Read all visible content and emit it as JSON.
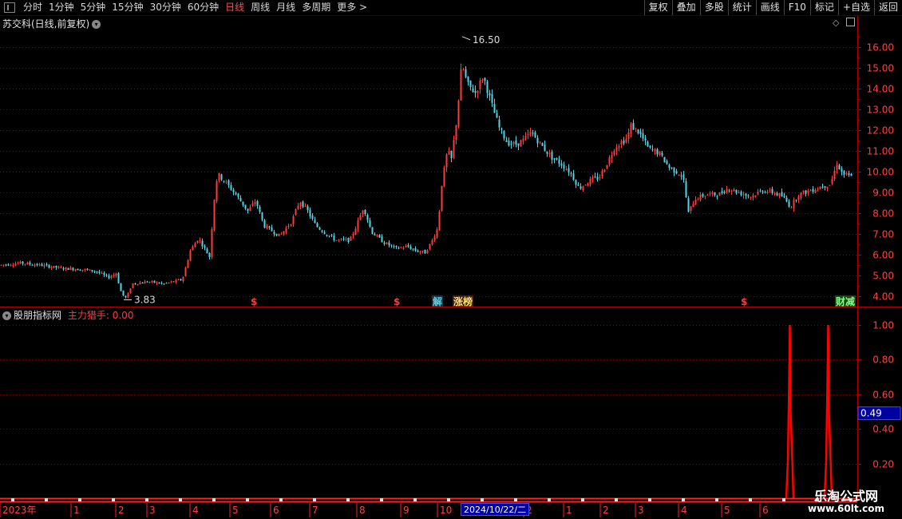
{
  "toolbar": {
    "tabs": [
      "分时",
      "1分钟",
      "5分钟",
      "15分钟",
      "30分钟",
      "60分钟",
      "日线",
      "周线",
      "月线",
      "多周期",
      "更多 >"
    ],
    "active_tab": 6,
    "right_buttons": [
      "复权",
      "叠加",
      "多股",
      "统计",
      "画线",
      "F10",
      "标记",
      "+自选",
      "返回"
    ]
  },
  "main_panel": {
    "title": "苏交科(日线,前复权)",
    "y_ticks": [
      "16.00",
      "15.00",
      "14.00",
      "13.00",
      "12.00",
      "11.00",
      "10.00",
      "9.00",
      "8.00",
      "7.00",
      "6.00",
      "5.00",
      "4.00"
    ],
    "max_label": "16.50",
    "min_label": "3.83",
    "markers": [
      "$",
      "$",
      "解",
      "涨榜",
      "$",
      "财减"
    ]
  },
  "indicator_panel": {
    "title": "股朋指标网",
    "series_name": "主力猎手",
    "series_value": "0.00",
    "y_ticks": [
      "1.00",
      "0.80",
      "0.60",
      "0.40",
      "0.20"
    ],
    "current_value": "0.49"
  },
  "x_axis": {
    "labels": [
      "2023年",
      "1",
      "2",
      "3",
      "4",
      "5",
      "6",
      "7",
      "8",
      "9",
      "10",
      "2",
      "1",
      "2",
      "3",
      "4",
      "5",
      "6"
    ],
    "selected_date": "2024/10/22/二"
  },
  "watermark": {
    "title": "乐淘公式网",
    "url": "www.60lt.com"
  },
  "colors": {
    "up": "#ff3c3c",
    "down": "#54d4e4",
    "grid": "#8a0000",
    "axis": "#b00000",
    "selected": "#0000a0",
    "indicator": "#ff0000"
  },
  "chart_data": {
    "type": "candlestick",
    "title": "苏交科(日线,前复权)",
    "ylim": [
      3.5,
      16.8
    ],
    "y_ticks": [
      4,
      5,
      6,
      7,
      8,
      9,
      10,
      11,
      12,
      13,
      14,
      15,
      16
    ],
    "max": 16.5,
    "min": 3.83,
    "indicator": {
      "name": "主力猎手",
      "ylim": [
        0,
        1.05
      ],
      "spikes": [
        1.0,
        1.0
      ]
    },
    "price_path": [
      [
        0,
        5.5
      ],
      [
        25,
        5.6
      ],
      [
        50,
        5.5
      ],
      [
        75,
        5.35
      ],
      [
        100,
        5.3
      ],
      [
        120,
        5.2
      ],
      [
        135,
        4.9
      ],
      [
        145,
        5.1
      ],
      [
        152,
        4.1
      ],
      [
        158,
        3.9
      ],
      [
        165,
        4.6
      ],
      [
        185,
        4.7
      ],
      [
        205,
        4.6
      ],
      [
        228,
        4.8
      ],
      [
        238,
        6.2
      ],
      [
        248,
        6.8
      ],
      [
        262,
        5.9
      ],
      [
        268,
        8.7
      ],
      [
        272,
        9.9
      ],
      [
        284,
        9.4
      ],
      [
        295,
        8.9
      ],
      [
        310,
        8.1
      ],
      [
        320,
        8.6
      ],
      [
        330,
        7.4
      ],
      [
        350,
        6.9
      ],
      [
        365,
        7.6
      ],
      [
        375,
        8.6
      ],
      [
        385,
        8.1
      ],
      [
        395,
        7.4
      ],
      [
        405,
        7.1
      ],
      [
        420,
        6.7
      ],
      [
        438,
        6.7
      ],
      [
        445,
        7.3
      ],
      [
        455,
        8.3
      ],
      [
        465,
        7.1
      ],
      [
        480,
        6.6
      ],
      [
        495,
        6.3
      ],
      [
        510,
        6.4
      ],
      [
        520,
        6.2
      ],
      [
        532,
        6.1
      ],
      [
        540,
        6.6
      ],
      [
        548,
        7.3
      ],
      [
        553,
        9.4
      ],
      [
        560,
        11.0
      ],
      [
        565,
        10.6
      ],
      [
        572,
        12.6
      ],
      [
        578,
        15.2
      ],
      [
        585,
        14.2
      ],
      [
        595,
        13.8
      ],
      [
        605,
        14.6
      ],
      [
        615,
        13.3
      ],
      [
        625,
        12.1
      ],
      [
        635,
        11.4
      ],
      [
        645,
        11.3
      ],
      [
        655,
        11.5
      ],
      [
        665,
        11.9
      ],
      [
        675,
        11.4
      ],
      [
        690,
        10.7
      ],
      [
        705,
        10.3
      ],
      [
        715,
        9.9
      ],
      [
        725,
        9.2
      ],
      [
        740,
        9.6
      ],
      [
        750,
        9.7
      ],
      [
        760,
        10.4
      ],
      [
        770,
        11.2
      ],
      [
        785,
        11.6
      ],
      [
        790,
        12.2
      ],
      [
        800,
        11.9
      ],
      [
        812,
        11.1
      ],
      [
        825,
        10.9
      ],
      [
        838,
        10.2
      ],
      [
        855,
        9.8
      ],
      [
        862,
        8.0
      ],
      [
        870,
        8.7
      ],
      [
        885,
        8.9
      ],
      [
        900,
        8.9
      ],
      [
        912,
        9.2
      ],
      [
        925,
        9.0
      ],
      [
        940,
        8.8
      ],
      [
        955,
        9.1
      ],
      [
        968,
        9.0
      ],
      [
        980,
        8.8
      ],
      [
        990,
        8.3
      ],
      [
        1000,
        8.9
      ],
      [
        1015,
        9.1
      ],
      [
        1030,
        9.3
      ],
      [
        1040,
        9.4
      ],
      [
        1048,
        10.4
      ],
      [
        1055,
        9.9
      ],
      [
        1068,
        9.7
      ]
    ]
  }
}
